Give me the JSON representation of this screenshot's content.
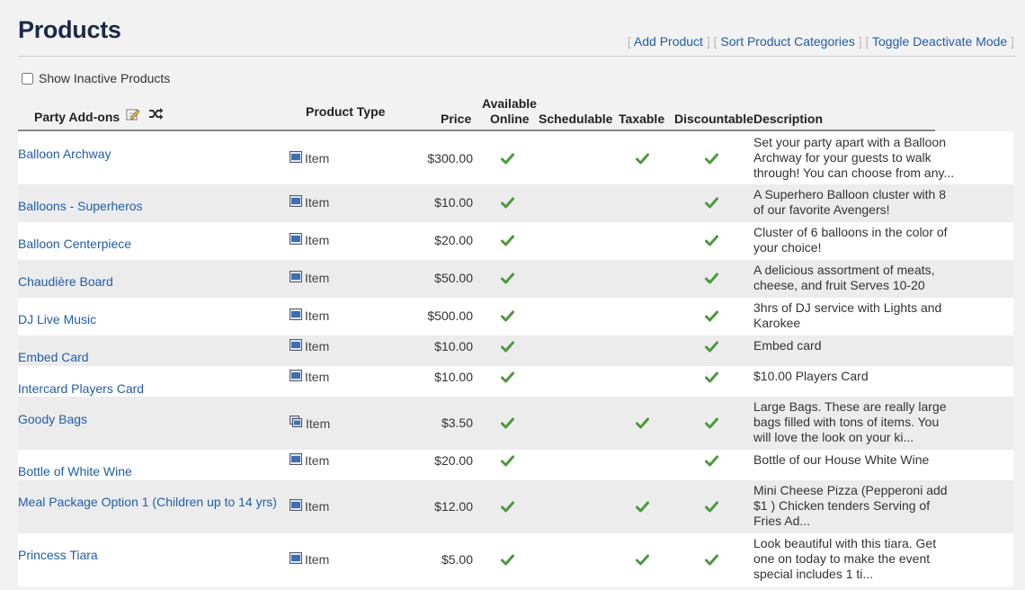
{
  "page": {
    "title": "Products",
    "actions": [
      "Add Product",
      "Sort Product Categories",
      "Toggle Deactivate Mode"
    ],
    "show_inactive_label": "Show Inactive Products",
    "show_inactive_checked": false
  },
  "table": {
    "category": "Party Add-ons",
    "headers": {
      "product_type": "Product Type",
      "price": "Price",
      "available_online_1": "Available",
      "available_online_2": "Online",
      "schedulable": "Schedulable",
      "taxable": "Taxable",
      "discountable": "Discountable",
      "description": "Description"
    },
    "rows": [
      {
        "name": "Balloon Archway",
        "type": "Item",
        "type_icon": "item-icon",
        "price": "$300.00",
        "online": true,
        "schedulable": false,
        "taxable": true,
        "discountable": true,
        "desc": [
          "Set your party apart with a Balloon",
          "Archway for your guests to walk",
          "through! You can choose from any..."
        ]
      },
      {
        "name": "Balloons - Superheros",
        "type": "Item",
        "type_icon": "item-icon",
        "price": "$10.00",
        "online": true,
        "schedulable": false,
        "taxable": false,
        "discountable": true,
        "desc": [
          "A Superhero Balloon cluster with 8",
          "of our favorite Avengers!"
        ]
      },
      {
        "name": "Balloon Centerpiece",
        "type": "Item",
        "type_icon": "item-icon",
        "price": "$20.00",
        "online": true,
        "schedulable": false,
        "taxable": false,
        "discountable": true,
        "desc": [
          "Cluster of 6 balloons in the color of",
          "your choice!"
        ]
      },
      {
        "name": "Chaudière Board",
        "type": "Item",
        "type_icon": "item-icon",
        "price": "$50.00",
        "online": true,
        "schedulable": false,
        "taxable": false,
        "discountable": true,
        "desc": [
          "A delicious assortment of meats,",
          "cheese, and fruit  Serves 10-20"
        ]
      },
      {
        "name": "DJ Live Music",
        "type": "Item",
        "type_icon": "item-icon",
        "price": "$500.00",
        "online": true,
        "schedulable": false,
        "taxable": false,
        "discountable": true,
        "desc": [
          "3hrs of DJ service with Lights and",
          "Karokee"
        ]
      },
      {
        "name": "Embed Card",
        "type": "Item",
        "type_icon": "item-icon",
        "price": "$10.00",
        "online": true,
        "schedulable": false,
        "taxable": false,
        "discountable": true,
        "desc": [
          "Embed card"
        ]
      },
      {
        "name": "Intercard Players Card",
        "type": "Item",
        "type_icon": "item-icon",
        "price": "$10.00",
        "online": true,
        "schedulable": false,
        "taxable": false,
        "discountable": true,
        "desc": [
          "$10.00 Players Card"
        ]
      },
      {
        "name": "Goody Bags",
        "type": "Item",
        "type_icon": "item-group-icon",
        "price": "$3.50",
        "online": true,
        "schedulable": false,
        "taxable": true,
        "discountable": true,
        "desc": [
          "Large Bags. These are really large",
          "bags filled with tons of items. You",
          "will love the look on your ki..."
        ]
      },
      {
        "name": "Bottle of White Wine",
        "type": "Item",
        "type_icon": "item-icon",
        "price": "$20.00",
        "online": true,
        "schedulable": false,
        "taxable": false,
        "discountable": true,
        "desc": [
          "Bottle of our House White Wine"
        ]
      },
      {
        "name": "Meal Package Option 1 (Children up to 14 yrs)",
        "type": "Item",
        "type_icon": "item-icon",
        "price": "$12.00",
        "online": true,
        "schedulable": false,
        "taxable": true,
        "discountable": true,
        "desc": [
          "Mini Cheese Pizza (Pepperoni add",
          "$1 )  Chicken tenders  Serving of",
          "Fries  Ad..."
        ]
      },
      {
        "name": "Princess Tiara",
        "type": "Item",
        "type_icon": "item-icon",
        "price": "$5.00",
        "online": true,
        "schedulable": false,
        "taxable": true,
        "discountable": true,
        "desc": [
          "Look beautiful with this tiara.  Get",
          "one on today to make the event",
          "special includes 1 ti..."
        ]
      }
    ]
  },
  "colors": {
    "link": "#1e5eab",
    "check": "#4a9a3a",
    "row_alt": "#ececec",
    "row_white": "#ffffff",
    "page_bg": "#f2f2f2"
  }
}
